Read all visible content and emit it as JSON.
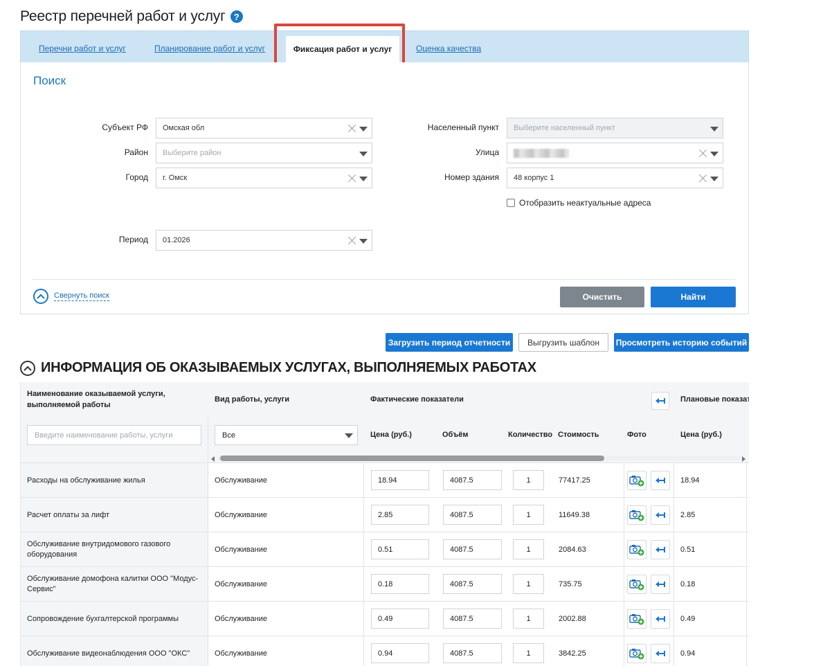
{
  "page": {
    "title": "Реестр перечней работ и услуг",
    "help_icon": "?"
  },
  "tabs": [
    {
      "label": "Перечни работ и услуг",
      "active": false
    },
    {
      "label": "Планирование работ и услуг",
      "active": false
    },
    {
      "label": "Фиксация работ и услуг",
      "active": true
    },
    {
      "label": "Оценка качества",
      "active": false
    }
  ],
  "search": {
    "title": "Поиск",
    "fields": {
      "subject": {
        "label": "Субъект РФ",
        "value": "Омская обл"
      },
      "district": {
        "label": "Район",
        "placeholder": "Выберите район"
      },
      "city": {
        "label": "Город",
        "value": "г. Омск"
      },
      "period": {
        "label": "Период",
        "value": "01.2026"
      },
      "settlement": {
        "label": "Населенный пункт",
        "placeholder": "Выберите населенный пункт"
      },
      "street": {
        "label": "Улица",
        "value": ""
      },
      "building": {
        "label": "Номер здания",
        "value": "48 корпус 1"
      }
    },
    "checkbox_label": "Отобразить неактуальные адреса",
    "collapse_label": "Свернуть поиск",
    "clear_button": "Очистить",
    "find_button": "Найти"
  },
  "actions": {
    "upload_period": "Загрузить период отчетности",
    "export_template": "Выгрузить шаблон",
    "view_history": "Просмотреть историю событий"
  },
  "section": {
    "title": "ИНФОРМАЦИЯ ОБ ОКАЗЫВАЕМЫХ УСЛУГАХ, ВЫПОЛНЯЕМЫХ РАБОТАХ"
  },
  "table": {
    "headers": {
      "name": "Наименование оказываемой услуги, выполняемой работы",
      "type": "Вид работы, услуги",
      "actual": "Фактические показатели",
      "planned": "Плановые показат",
      "price": "Цена (руб.)",
      "volume": "Объём",
      "quantity": "Количество",
      "cost": "Стоимость",
      "photo": "Фото",
      "plan_price": "Цена (руб.)"
    },
    "filter_name_placeholder": "Введите наименование работы, услуги",
    "filter_type_value": "Все",
    "rows": [
      {
        "name": "Расходы на обслуживание жилья",
        "type": "Обслуживание",
        "price": "18.94",
        "volume": "4087.5",
        "quantity": "1",
        "cost": "77417.25",
        "plan_price": "18.94"
      },
      {
        "name": "Расчет оплаты за лифт",
        "type": "Обслуживание",
        "price": "2.85",
        "volume": "4087.5",
        "quantity": "1",
        "cost": "11649.38",
        "plan_price": "2.85"
      },
      {
        "name": "Обслуживание внутридомового газового оборудования",
        "type": "Обслуживание",
        "price": "0.51",
        "volume": "4087.5",
        "quantity": "1",
        "cost": "2084.63",
        "plan_price": "0.51"
      },
      {
        "name": "Обслуживание домофона калитки ООО \"Модус-Сервис\"",
        "type": "Обслуживание",
        "price": "0.18",
        "volume": "4087.5",
        "quantity": "1",
        "cost": "735.75",
        "plan_price": "0.18"
      },
      {
        "name": "Сопровождение бухгалтерской программы",
        "type": "Обслуживание",
        "price": "0.49",
        "volume": "4087.5",
        "quantity": "1",
        "cost": "2002.88",
        "plan_price": "0.49"
      },
      {
        "name": "Обслуживание видеонаблюдения ООО \"ОКС\"",
        "type": "Обслуживание",
        "price": "0.94",
        "volume": "4087.5",
        "quantity": "1",
        "cost": "3842.25",
        "plan_price": "0.94"
      }
    ]
  },
  "colors": {
    "accent": "#1a78d2",
    "tabs_bg": "#cde4f5",
    "highlight": "#d9473a"
  }
}
